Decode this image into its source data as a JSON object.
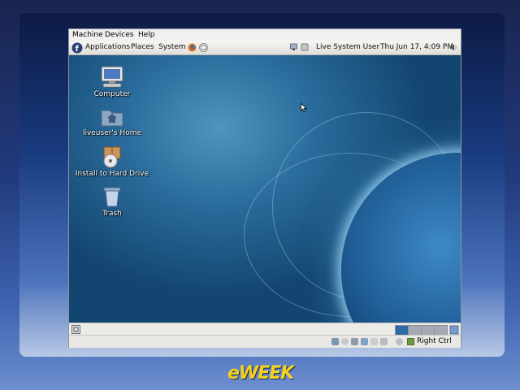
{
  "vm_menu": {
    "machine": "Machine",
    "devices": "Devices",
    "help": "Help"
  },
  "panel": {
    "applications": "Applications",
    "places": "Places",
    "system": "System",
    "user": "Live System User",
    "clock": "Thu Jun 17,  4:09 PM"
  },
  "desktop_icons": {
    "computer": "Computer",
    "home": "liveuser's Home",
    "install": "Install to Hard Drive",
    "trash": "Trash"
  },
  "status": {
    "host_key": "Right Ctrl"
  },
  "brand": {
    "logo": "eWEEK"
  }
}
